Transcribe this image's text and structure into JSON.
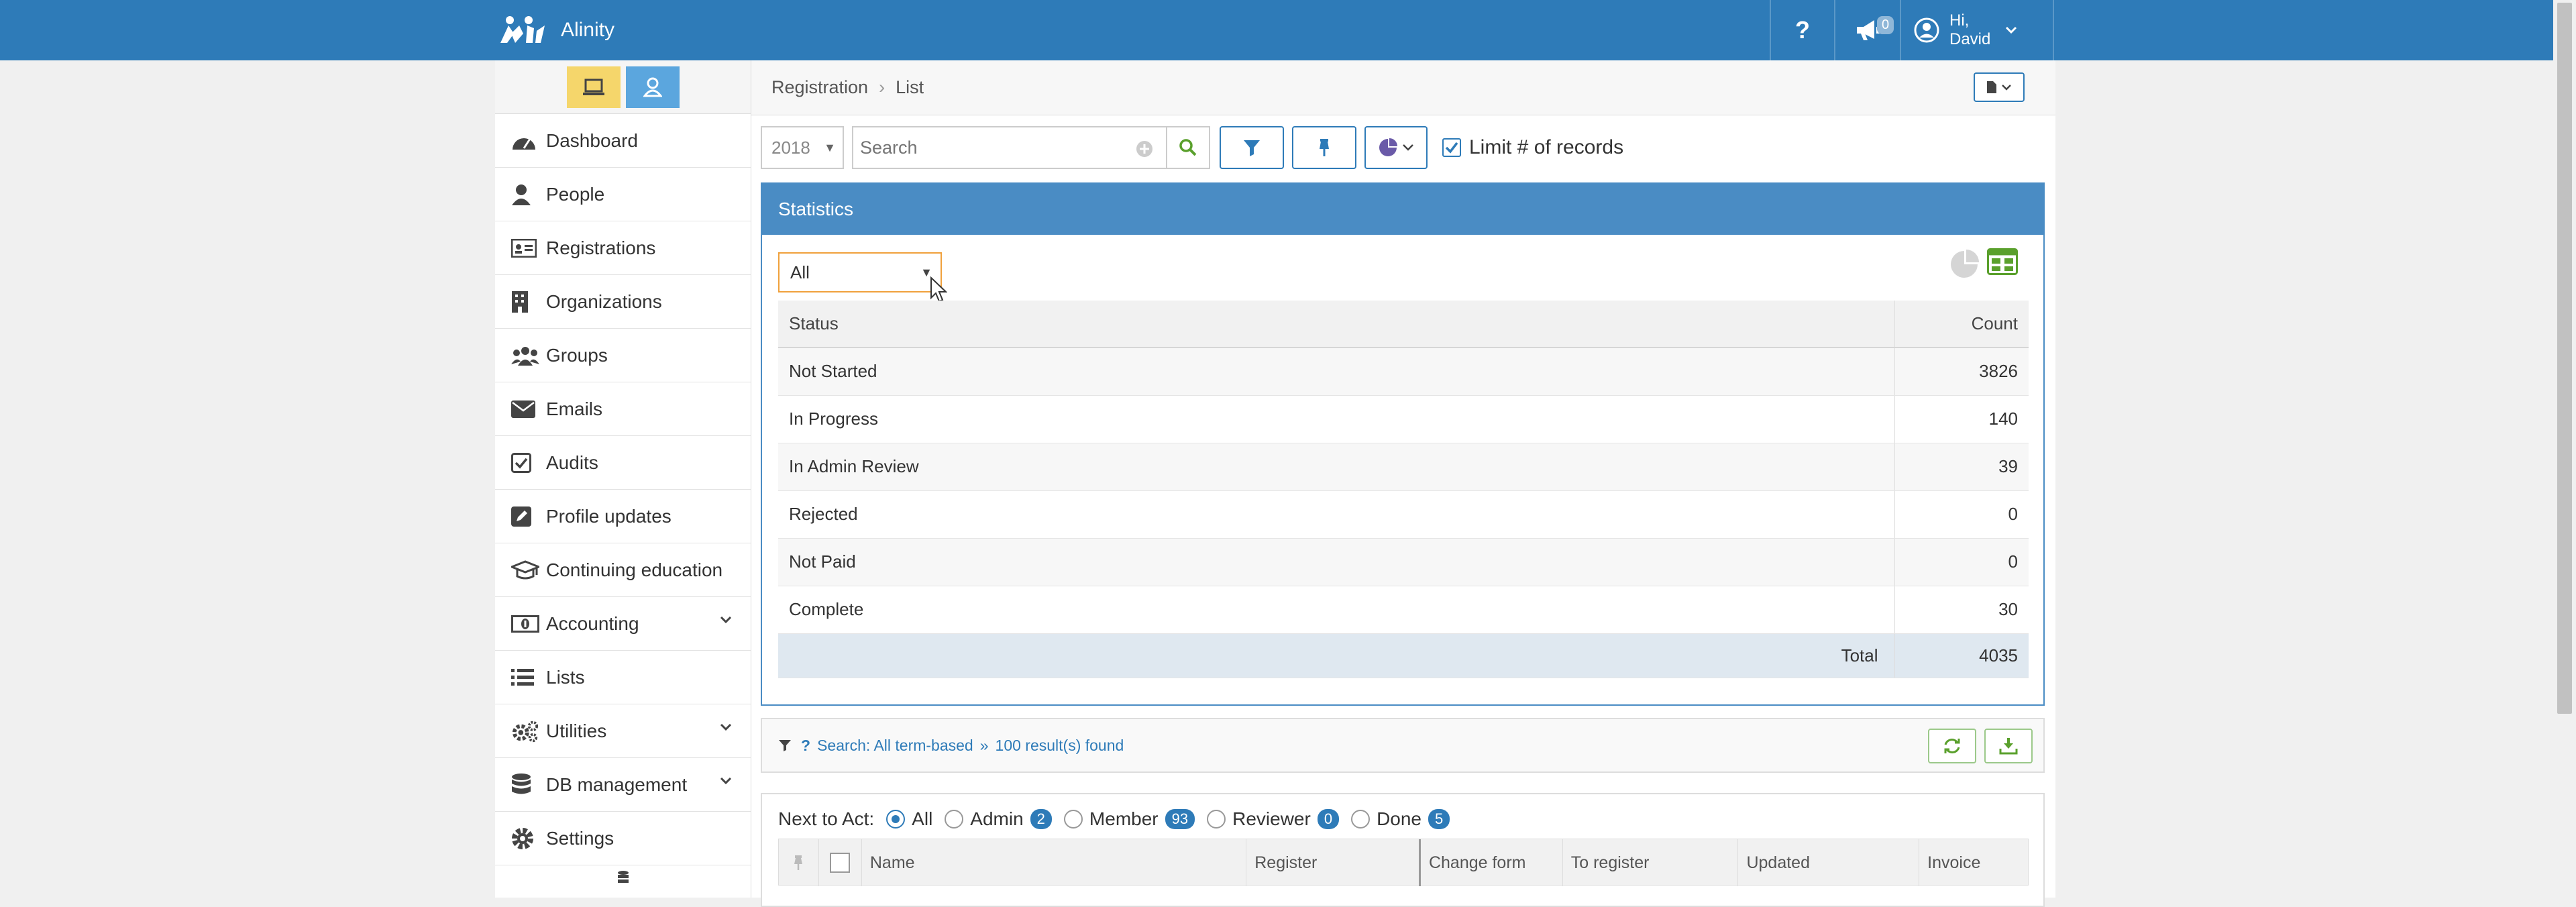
{
  "app": {
    "name": "Alinity"
  },
  "header": {
    "help_label": "?",
    "notifications_count": "0",
    "user_greeting_line1": "Hi,",
    "user_greeting_line2": "David"
  },
  "sidebar": {
    "items": [
      {
        "label": "Dashboard",
        "icon": "dashboard-icon"
      },
      {
        "label": "People",
        "icon": "person-icon"
      },
      {
        "label": "Registrations",
        "icon": "id-card-icon"
      },
      {
        "label": "Organizations",
        "icon": "building-icon"
      },
      {
        "label": "Groups",
        "icon": "group-icon"
      },
      {
        "label": "Emails",
        "icon": "envelope-icon"
      },
      {
        "label": "Audits",
        "icon": "checkbox-icon"
      },
      {
        "label": "Profile updates",
        "icon": "edit-icon"
      },
      {
        "label": "Continuing education",
        "icon": "graduation-cap-icon"
      },
      {
        "label": "Accounting",
        "icon": "money-icon"
      },
      {
        "label": "Lists",
        "icon": "list-icon"
      },
      {
        "label": "Utilities",
        "icon": "cogs-icon"
      },
      {
        "label": "DB management",
        "icon": "database-icon"
      },
      {
        "label": "Settings",
        "icon": "gear-icon"
      }
    ]
  },
  "breadcrumb": {
    "section": "Registration",
    "page": "List"
  },
  "toolbar": {
    "year": "2018",
    "search_placeholder": "Search",
    "limit_label": "Limit # of records",
    "limit_checked": true
  },
  "statistics": {
    "title": "Statistics",
    "filter_value": "All",
    "columns": {
      "status": "Status",
      "count": "Count"
    },
    "rows": [
      {
        "status": "Not Started",
        "count": "3826"
      },
      {
        "status": "In Progress",
        "count": "140"
      },
      {
        "status": "In Admin Review",
        "count": "39"
      },
      {
        "status": "Rejected",
        "count": "0"
      },
      {
        "status": "Not Paid",
        "count": "0"
      },
      {
        "status": "Complete",
        "count": "30"
      }
    ],
    "total_label": "Total",
    "total_value": "4035"
  },
  "search_info": {
    "query_text": "Search: All term-based",
    "results_text": "100 result(s) found"
  },
  "next_to_act": {
    "label": "Next to Act:",
    "options": [
      {
        "label": "All",
        "count": null,
        "checked": true
      },
      {
        "label": "Admin",
        "count": "2",
        "checked": false
      },
      {
        "label": "Member",
        "count": "93",
        "checked": false
      },
      {
        "label": "Reviewer",
        "count": "0",
        "checked": false
      },
      {
        "label": "Done",
        "count": "5",
        "checked": false
      }
    ]
  },
  "results_table": {
    "columns": [
      "Name",
      "Register",
      "Change form",
      "To register",
      "Updated",
      "Invoice"
    ]
  },
  "colors": {
    "brand_blue": "#2e7bb8",
    "stats_header": "#4a8cc4",
    "select_border": "#f0a13c",
    "desktop_toggle": "#f5d66b",
    "person_toggle": "#5ba6de",
    "green_accent": "#5aa02c"
  }
}
